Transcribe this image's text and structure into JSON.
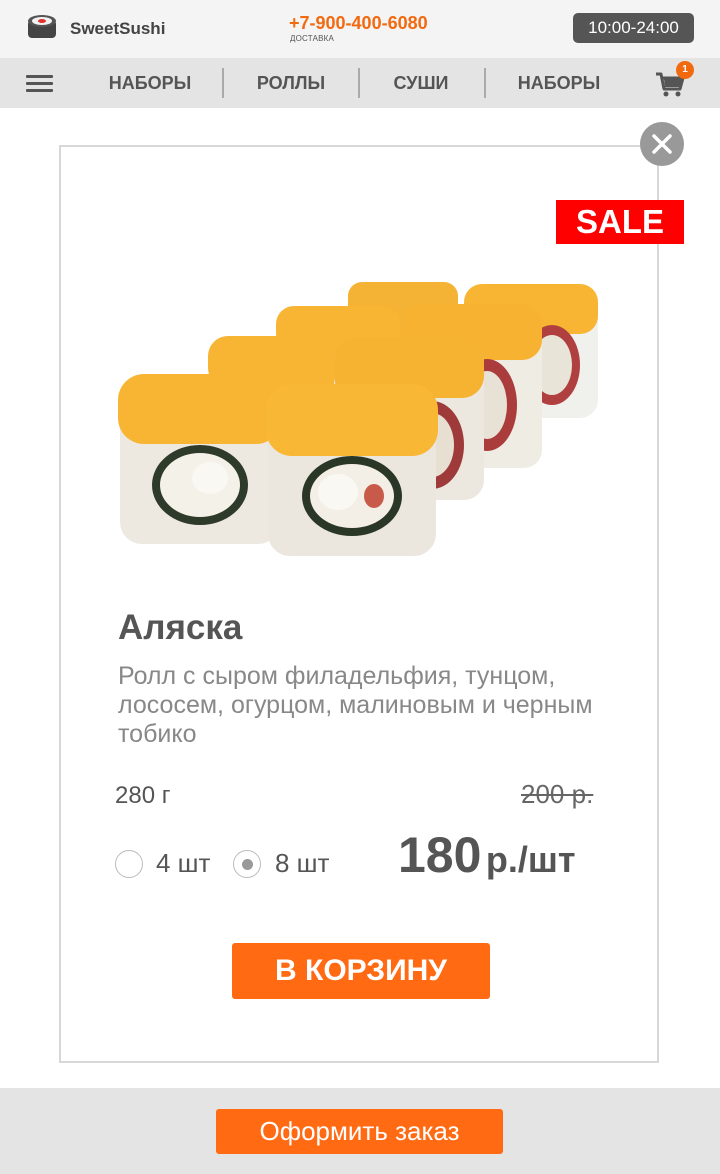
{
  "header": {
    "brand": "SweetSushi",
    "phone": "+7-900-400-6080",
    "delivery_label": "ДОСТАВКА",
    "hours": "10:00-24:00"
  },
  "nav": {
    "items": [
      {
        "label": "НАБОРЫ"
      },
      {
        "label": "РОЛЛЫ"
      },
      {
        "label": "СУШИ"
      },
      {
        "label": "НАБОРЫ"
      }
    ],
    "cart_count": "1"
  },
  "product": {
    "badge": "SALE",
    "name": "Аляска",
    "description": "Ролл с сыром филадельфия, тунцом, лососем, огурцом, малиновым и черным тобико",
    "weight": "280 г",
    "old_price": "200 р.",
    "price": "180",
    "price_unit": "р./шт",
    "options": [
      {
        "label": "4 шт",
        "selected": false
      },
      {
        "label": "8 шт",
        "selected": true
      }
    ],
    "add_to_cart": "В КОРЗИНУ",
    "image_icon": "sushi-rolls-image"
  },
  "footer": {
    "checkout": "Оформить заказ"
  },
  "colors": {
    "accent": "#ff6a13",
    "sale": "#ff0000",
    "text": "#555555"
  }
}
